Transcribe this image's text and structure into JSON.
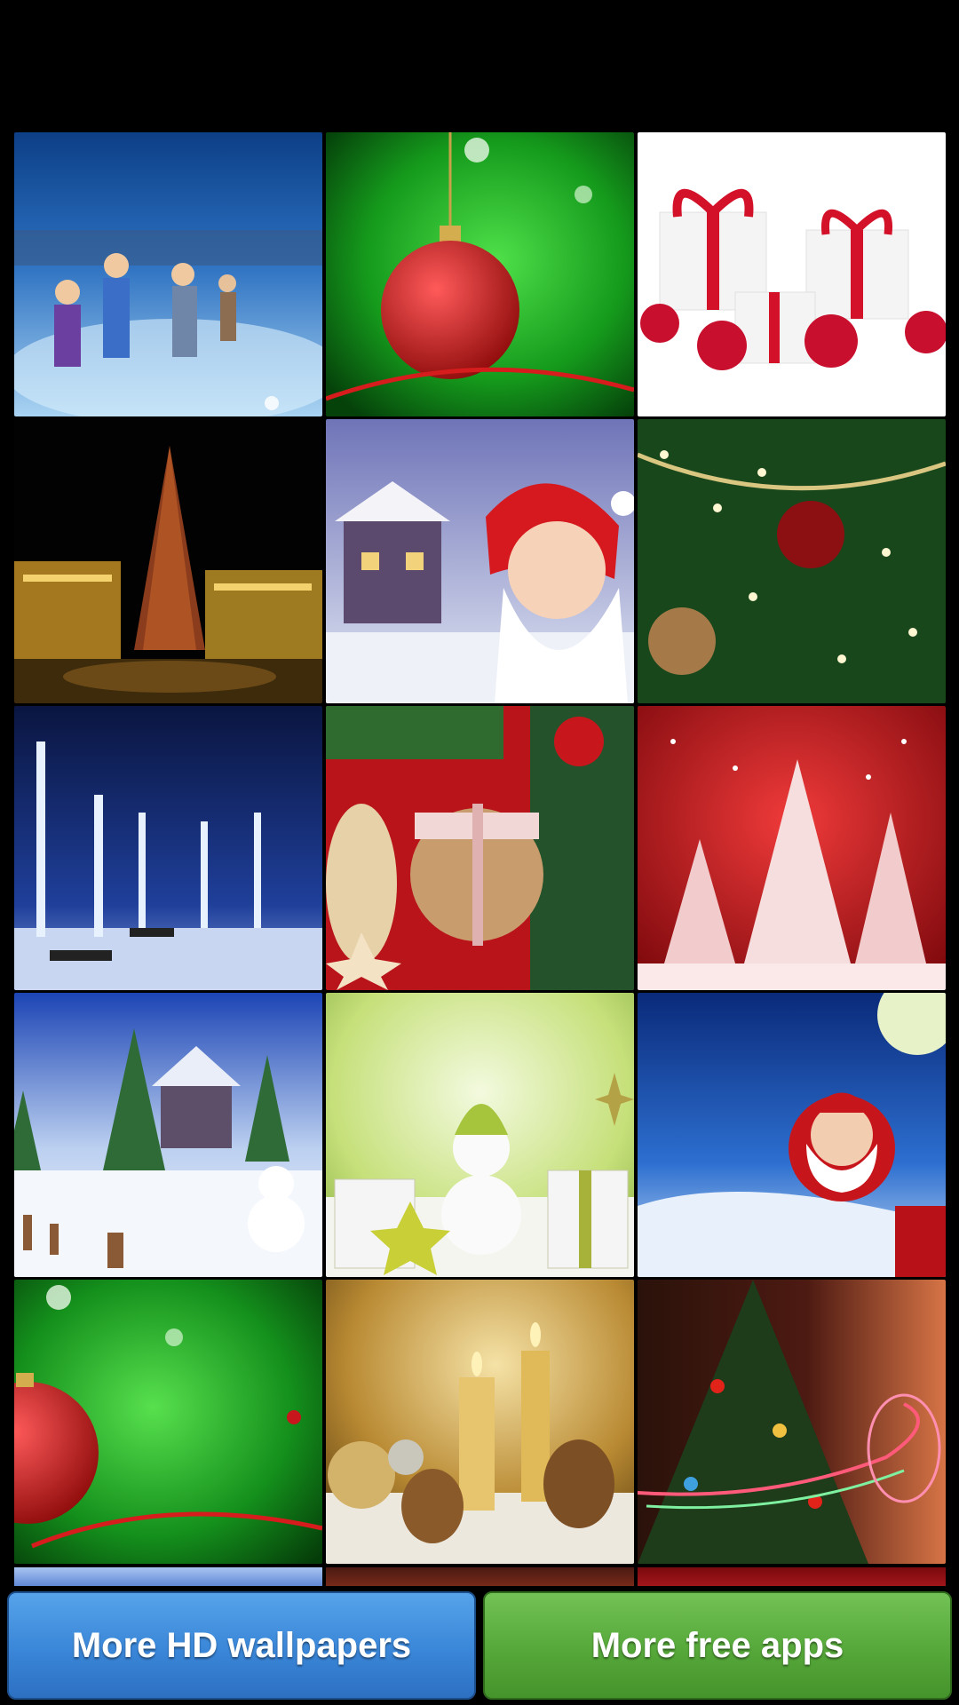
{
  "wallpapers": [
    {
      "theme": "ice-skating-family"
    },
    {
      "theme": "green-red-ornament"
    },
    {
      "theme": "red-gifts-white"
    },
    {
      "theme": "night-plaza-tree"
    },
    {
      "theme": "santa-snow-house"
    },
    {
      "theme": "tree-lights-closeup"
    },
    {
      "theme": "snowy-lit-park"
    },
    {
      "theme": "cookies-ribbon"
    },
    {
      "theme": "red-white-trees"
    },
    {
      "theme": "snow-house-snowman"
    },
    {
      "theme": "green-snowman-gifts"
    },
    {
      "theme": "santa-moon-night"
    },
    {
      "theme": "green-red-ornament-2"
    },
    {
      "theme": "golden-candles"
    },
    {
      "theme": "tree-light-swirl"
    }
  ],
  "buttons": {
    "more_wallpapers": "More HD wallpapers",
    "more_apps": "More free apps"
  },
  "colors": {
    "background": "#000000",
    "wallpapers_button": "#3a86d8",
    "apps_button": "#56a83a"
  }
}
